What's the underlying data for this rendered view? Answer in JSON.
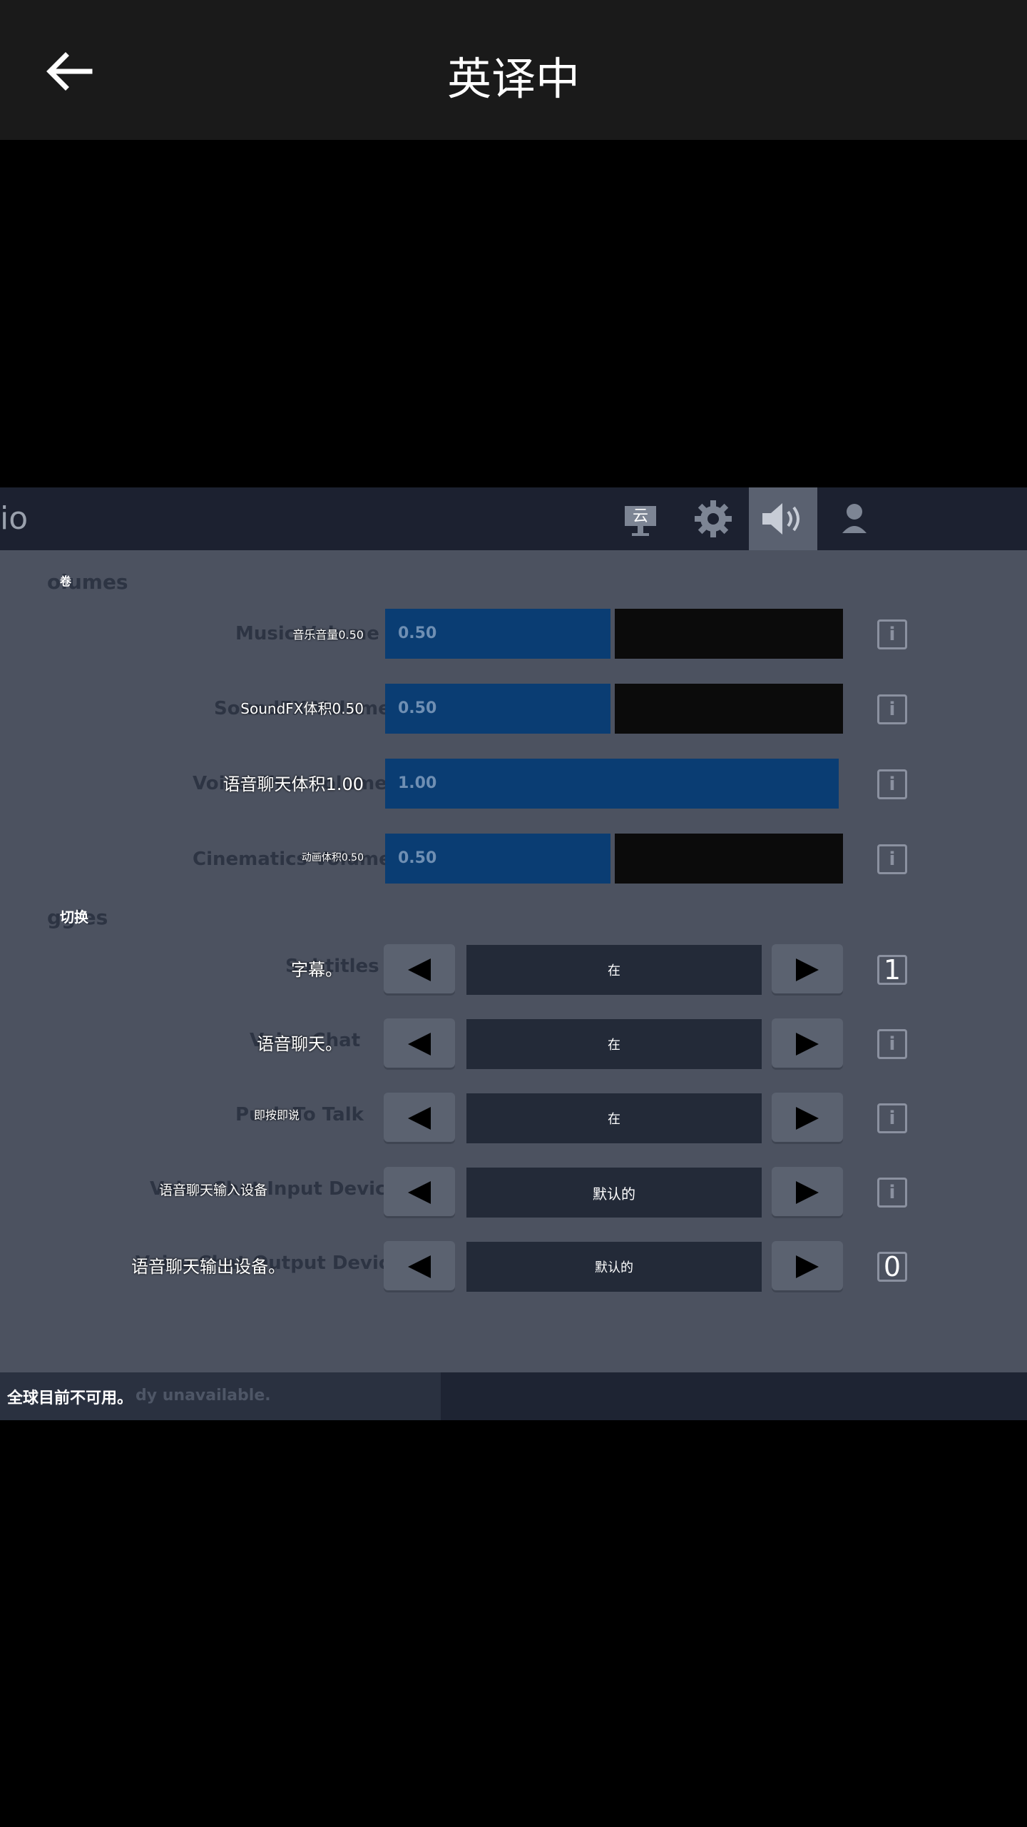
{
  "header": {
    "title": "英译中",
    "back_icon": "back-arrow-icon"
  },
  "game": {
    "title_fragment": "io",
    "tabs": [
      {
        "name": "display",
        "label": "云"
      },
      {
        "name": "settings",
        "label": ""
      },
      {
        "name": "audio",
        "label": ""
      },
      {
        "name": "account",
        "label": ""
      }
    ],
    "sections": {
      "volumes": {
        "label": "卷",
        "ghost": "olumes"
      },
      "toggles": {
        "label": "切换",
        "ghost": "ggles"
      }
    },
    "volumes": [
      {
        "label": "音乐音量0.50",
        "ghost": "Music Volume",
        "value": "0.50",
        "fraction": 0.5
      },
      {
        "label": "SoundFX体积0.50",
        "ghost": "SoundFX Volume",
        "value": "0.50",
        "fraction": 0.5
      },
      {
        "label": "语音聊天体积1.00",
        "ghost": "Voice Chat Volume",
        "value": "1.00",
        "fraction": 1.0
      },
      {
        "label": "动画体积0.50",
        "ghost": "Cinematics Volume",
        "value": "0.50",
        "fraction": 0.5
      }
    ],
    "toggles": [
      {
        "label": "字幕。",
        "ghost": "Subtitles",
        "value": "在",
        "info": "1"
      },
      {
        "label": "语音聊天。",
        "ghost": "Voice Chat",
        "value": "在",
        "info": "i"
      },
      {
        "label": "即按即说",
        "ghost": "Push To Talk",
        "value": "在",
        "info": "i"
      },
      {
        "label": "语音聊天输入设备",
        "ghost": "Voice Chat Input Device",
        "value": "默认的",
        "info": "i"
      },
      {
        "label": "语音聊天输出设备。",
        "ghost": "Voice Chat Output Device",
        "value": "默认的",
        "info": "0"
      }
    ],
    "footer": {
      "message": "全球目前不可用。",
      "ghost": "dy unavailable."
    }
  },
  "colors": {
    "accent_fill": "#0a3d73",
    "panel": "#4c5260",
    "topbar": "#1a1a1a"
  }
}
